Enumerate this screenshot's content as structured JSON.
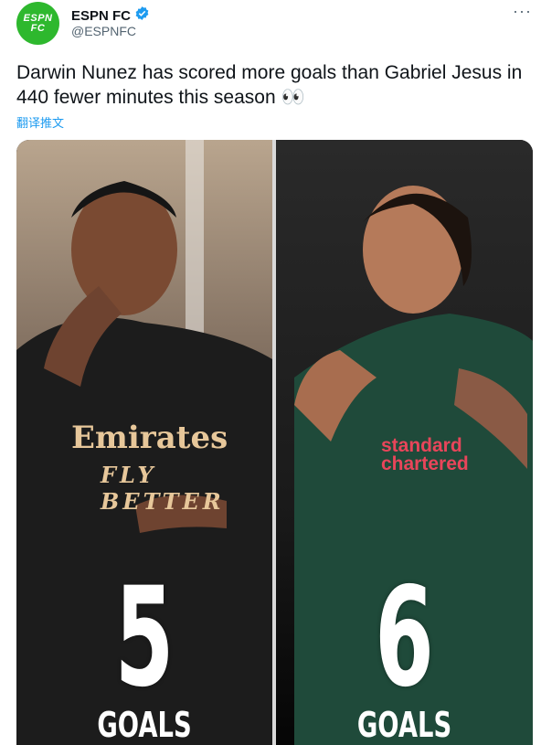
{
  "account": {
    "avatar_text": "ESPN\nFC",
    "display_name": "ESPN FC",
    "handle": "@ESPNFC"
  },
  "more_label": "···",
  "tweet": {
    "text": "Darwin Nunez has scored more goals than Gabriel Jesus in 440 fewer minutes this season 👀",
    "translate_label": "翻译推文"
  },
  "media": {
    "left": {
      "shirt_sponsor": "Emirates",
      "shirt_sponsor_2": "FLY BETTER",
      "number": "5",
      "label": "GOALS"
    },
    "right": {
      "shirt_sponsor": "standard\nchartered",
      "number": "6",
      "label": "GOALS"
    }
  },
  "colors": {
    "brand_green": "#2eb82e",
    "verified_blue": "#1d9bf0",
    "arsenal_kit": "#1a1a1a",
    "liverpool_kit": "#1f4a3a"
  }
}
